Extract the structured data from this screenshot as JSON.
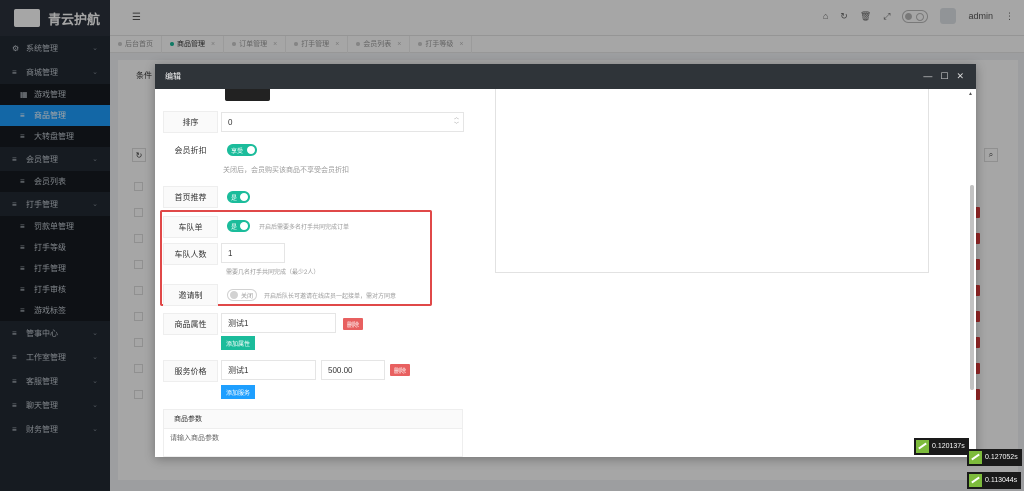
{
  "sidebar": {
    "brand": "青云护航",
    "items": [
      {
        "label": "系统管理",
        "icon": "gear-icon",
        "type": "group"
      },
      {
        "label": "商城管理",
        "icon": "list-icon",
        "type": "group"
      },
      {
        "label": "游戏管理",
        "icon": "calendar-icon",
        "type": "sub"
      },
      {
        "label": "商品管理",
        "icon": "list-icon",
        "type": "sub-active"
      },
      {
        "label": "大转盘管理",
        "icon": "list-icon",
        "type": "sub"
      },
      {
        "label": "会员管理",
        "icon": "list-icon",
        "type": "group"
      },
      {
        "label": "会员列表",
        "icon": "list-icon",
        "type": "sub"
      },
      {
        "label": "打手管理",
        "icon": "list-icon",
        "type": "group"
      },
      {
        "label": "罚款单管理",
        "icon": "list-icon",
        "type": "sub"
      },
      {
        "label": "打手等级",
        "icon": "list-icon",
        "type": "sub"
      },
      {
        "label": "打手管理",
        "icon": "list-icon",
        "type": "sub"
      },
      {
        "label": "打手审核",
        "icon": "list-icon",
        "type": "sub"
      },
      {
        "label": "游戏标签",
        "icon": "list-icon",
        "type": "sub"
      },
      {
        "label": "管事中心",
        "icon": "list-icon",
        "type": "group"
      },
      {
        "label": "工作室管理",
        "icon": "list-icon",
        "type": "group"
      },
      {
        "label": "客服管理",
        "icon": "list-icon",
        "type": "group"
      },
      {
        "label": "聊天管理",
        "icon": "list-icon",
        "type": "group"
      },
      {
        "label": "财务管理",
        "icon": "list-icon",
        "type": "group"
      }
    ]
  },
  "topbar": {
    "username": "admin"
  },
  "tabs": [
    {
      "label": "后台首页",
      "closable": false,
      "active": false
    },
    {
      "label": "商品管理",
      "closable": true,
      "active": true
    },
    {
      "label": "订单管理",
      "closable": true,
      "active": false
    },
    {
      "label": "打手管理",
      "closable": true,
      "active": false
    },
    {
      "label": "会员列表",
      "closable": true,
      "active": false
    },
    {
      "label": "打手等级",
      "closable": true,
      "active": false
    }
  ],
  "background": {
    "filter_label": "条件"
  },
  "modal": {
    "title": "编辑",
    "sort": {
      "label": "排序",
      "value": "0"
    },
    "member_discount": {
      "label": "会员折扣",
      "switch_text": "享受",
      "hint": "关闭后，会员购买该商品不享受会员折扣"
    },
    "home_recommend": {
      "label": "首页推荐",
      "switch_text": "是"
    },
    "team_order": {
      "label": "车队单",
      "switch_text": "是",
      "hint": "开启后需要多名打手共同完成订单"
    },
    "team_size": {
      "label": "车队人数",
      "value": "1",
      "hint": "需要几名打手共同完成（最少2人）"
    },
    "invite": {
      "label": "邀请制",
      "switch_text": "关闭",
      "hint": "开启后队长可邀请在线店员一起接单，需对方同意"
    },
    "attributes": {
      "label": "商品属性",
      "value": "测试1",
      "delete": "删除",
      "add": "添加属性"
    },
    "service_price": {
      "label": "服务价格",
      "name": "测试1",
      "price": "500.00",
      "delete": "删除",
      "add": "添加服务"
    },
    "params": {
      "label": "商品参数",
      "placeholder": "请输入商品参数"
    }
  },
  "timers": [
    "0.120137s",
    "0.127052s",
    "0.113044s"
  ]
}
